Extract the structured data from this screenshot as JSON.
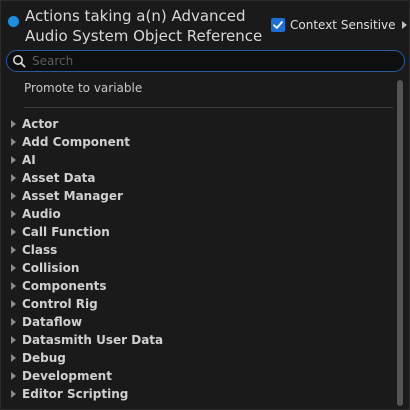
{
  "header": {
    "title_line1": "Actions taking a(n) Advanced",
    "title_line2": "Audio System Object Reference",
    "context_sensitive_label": "Context Sensitive",
    "context_sensitive_checked": true
  },
  "search": {
    "value": "",
    "placeholder": "Search"
  },
  "promote_label": "Promote to variable",
  "categories": [
    "Actor",
    "Add Component",
    "AI",
    "Asset Data",
    "Asset Manager",
    "Audio",
    "Call Function",
    "Class",
    "Collision",
    "Components",
    "Control Rig",
    "Dataflow",
    "Datasmith User Data",
    "Debug",
    "Development",
    "Editor Scripting"
  ],
  "icons": {
    "pin": "pin-dot-icon",
    "checkbox": "checkmark-icon",
    "context_menu": "triangle-right-icon",
    "search": "magnifier-icon",
    "expand": "triangle-right-icon"
  },
  "colors": {
    "pin": "#1a8fe0",
    "checkbox": "#1a6fd8",
    "search_border": "#2b5a9a",
    "background": "#1a1a1a"
  }
}
